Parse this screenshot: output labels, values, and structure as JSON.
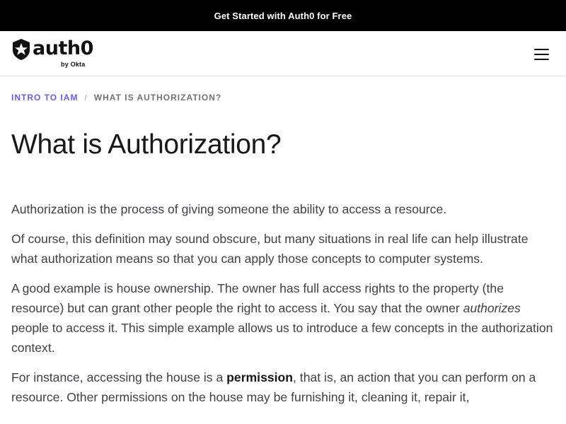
{
  "banner": {
    "text": "Get Started with Auth0 for Free"
  },
  "brand": {
    "name": "auth0",
    "sub": "by Okta"
  },
  "nav": {
    "menu_icon": "hamburger-menu-icon"
  },
  "breadcrumb": {
    "parent": "INTRO TO IAM",
    "separator": "/",
    "current": "WHAT IS AUTHORIZATION?"
  },
  "page": {
    "title": "What is Authorization?"
  },
  "article": {
    "p1": "Authorization is the process of giving someone the ability to access a resource.",
    "p2": "Of course, this definition may sound obscure, but many situations in real life can help illustrate what authorization means so that you can apply those concepts to computer systems.",
    "p3_a": "A good example is house ownership. The owner has full access rights to the property (the resource) but can grant other people the right to access it. You say that the owner ",
    "p3_em": "authorizes",
    "p3_b": " people to access it. This simple example allows us to introduce a few concepts in the authorization context.",
    "p4_a": "For instance, accessing the house is a ",
    "p4_strong": "permission",
    "p4_b": ", that is, an action that you can perform on a resource. Other permissions on the house may be furnishing it, cleaning it, repair it,"
  },
  "colors": {
    "banner_bg": "#000000",
    "accent": "#635dff",
    "text": "#3f3f46",
    "heading": "#18181b"
  }
}
